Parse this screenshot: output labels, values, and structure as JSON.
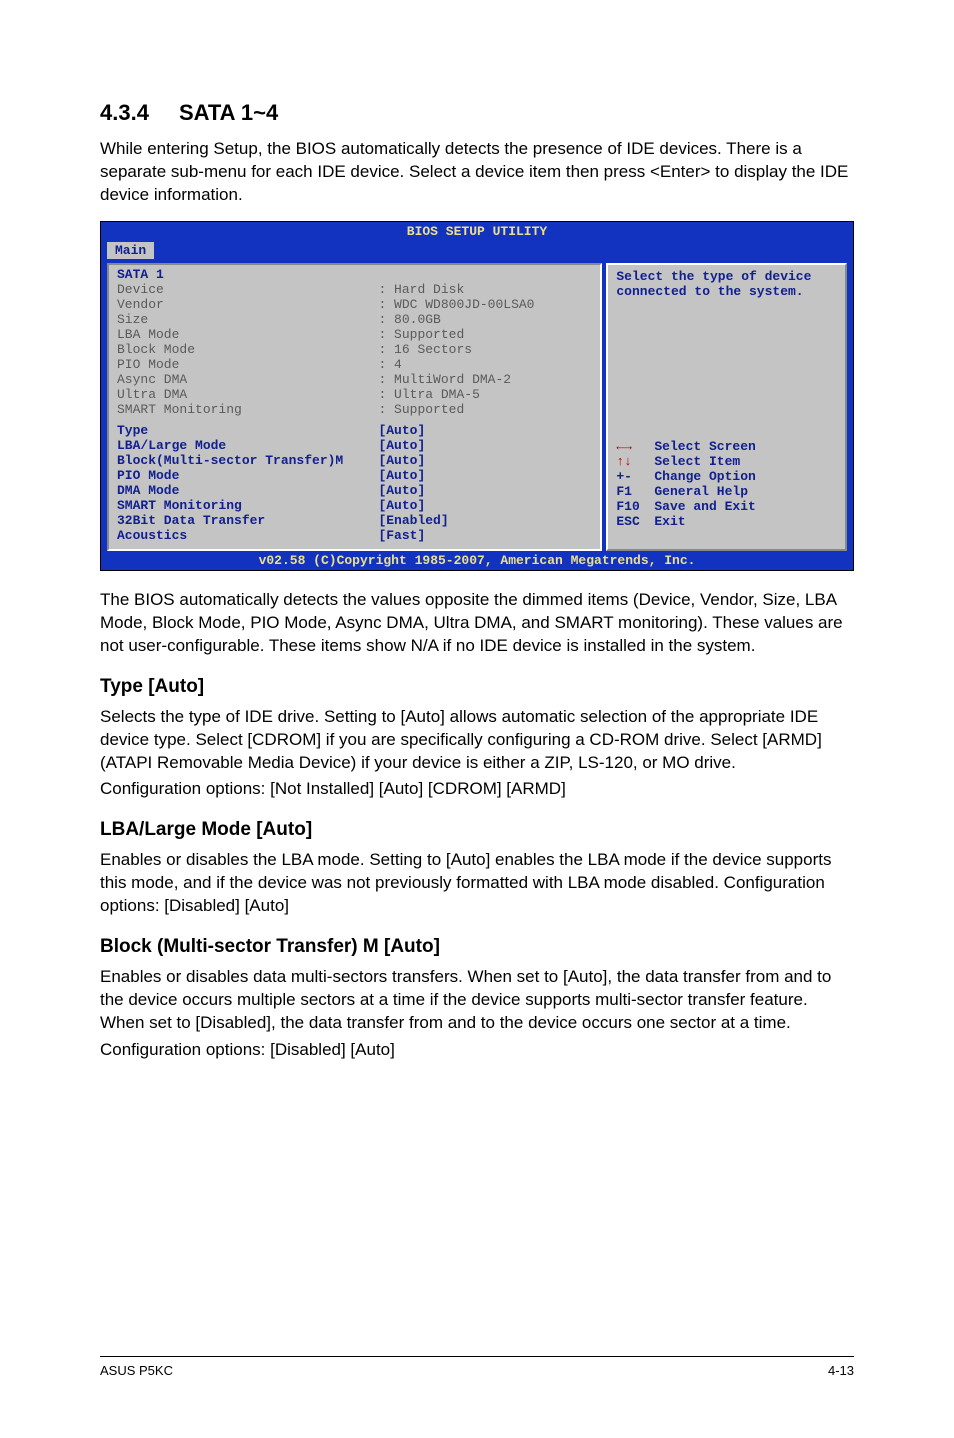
{
  "section": {
    "number": "4.3.4",
    "title": "SATA 1~4"
  },
  "intro": "While entering Setup, the BIOS automatically detects the presence of IDE devices. There is a separate sub-menu for each IDE device. Select a device item then press <Enter> to display the IDE device information.",
  "bios": {
    "header": "BIOS SETUP UTILITY",
    "tab": "Main",
    "panel_title": "SATA 1",
    "info": [
      {
        "label": "Device",
        "value": ": Hard Disk"
      },
      {
        "label": "Vendor",
        "value": ": WDC WD800JD-00LSA0"
      },
      {
        "label": "Size",
        "value": ": 80.0GB"
      },
      {
        "label": "LBA Mode",
        "value": ": Supported"
      },
      {
        "label": "Block Mode",
        "value": ": 16 Sectors"
      },
      {
        "label": "PIO Mode",
        "value": ": 4"
      },
      {
        "label": "Async DMA",
        "value": ": MultiWord DMA-2"
      },
      {
        "label": "Ultra DMA",
        "value": ": Ultra DMA-5"
      },
      {
        "label": "SMART Monitoring",
        "value": ": Supported"
      }
    ],
    "options": [
      {
        "label": "Type",
        "value": "[Auto]"
      },
      {
        "label": "LBA/Large Mode",
        "value": "[Auto]"
      },
      {
        "label": "Block(Multi-sector Transfer)M",
        "value": "[Auto]"
      },
      {
        "label": "PIO Mode",
        "value": "[Auto]"
      },
      {
        "label": "DMA Mode",
        "value": "[Auto]"
      },
      {
        "label": "SMART Monitoring",
        "value": "[Auto]"
      },
      {
        "label": "32Bit Data Transfer",
        "value": "[Enabled]"
      },
      {
        "label": "Acoustics",
        "value": "[Fast]"
      }
    ],
    "help_top": "Select the type of device connected to the system.",
    "keys": [
      {
        "key": "←→",
        "desc": "Select Screen",
        "red": true
      },
      {
        "key": "↑↓",
        "desc": "Select Item",
        "red": true
      },
      {
        "key": "+-",
        "desc": "Change Option"
      },
      {
        "key": "F1",
        "desc": "General Help"
      },
      {
        "key": "F10",
        "desc": "Save and Exit"
      },
      {
        "key": "ESC",
        "desc": "Exit"
      }
    ],
    "footer": "v02.58 (C)Copyright 1985-2007, American Megatrends, Inc."
  },
  "para_after_bios": "The BIOS automatically detects the values opposite the dimmed items (Device, Vendor, Size, LBA Mode, Block Mode, PIO Mode, Async DMA, Ultra DMA, and SMART monitoring). These values are not user-configurable. These items show N/A if no IDE device is installed in the system.",
  "type": {
    "heading": "Type [Auto]",
    "body": "Selects the type of IDE drive. Setting to [Auto] allows automatic selection of the appropriate IDE device type. Select [CDROM] if you are specifically configuring a CD-ROM drive. Select [ARMD] (ATAPI Removable Media Device) if your device is either a ZIP, LS-120, or MO drive.",
    "config": "Configuration options: [Not Installed] [Auto] [CDROM] [ARMD]"
  },
  "lba": {
    "heading": "LBA/Large Mode [Auto]",
    "body": "Enables or disables the LBA mode. Setting to [Auto] enables the LBA mode if the device supports this mode, and if the device was not previously formatted with LBA mode disabled. Configuration options: [Disabled] [Auto]"
  },
  "block": {
    "heading": "Block (Multi-sector Transfer) M [Auto]",
    "body": "Enables or disables data multi-sectors transfers. When set to [Auto], the data transfer from and to the device occurs multiple sectors at a time if the device supports multi-sector transfer feature. When set to [Disabled], the data transfer from and to the device occurs one sector at a time.",
    "config": "Configuration options: [Disabled] [Auto]"
  },
  "footer": {
    "left": "ASUS P5KC",
    "right": "4-13"
  }
}
